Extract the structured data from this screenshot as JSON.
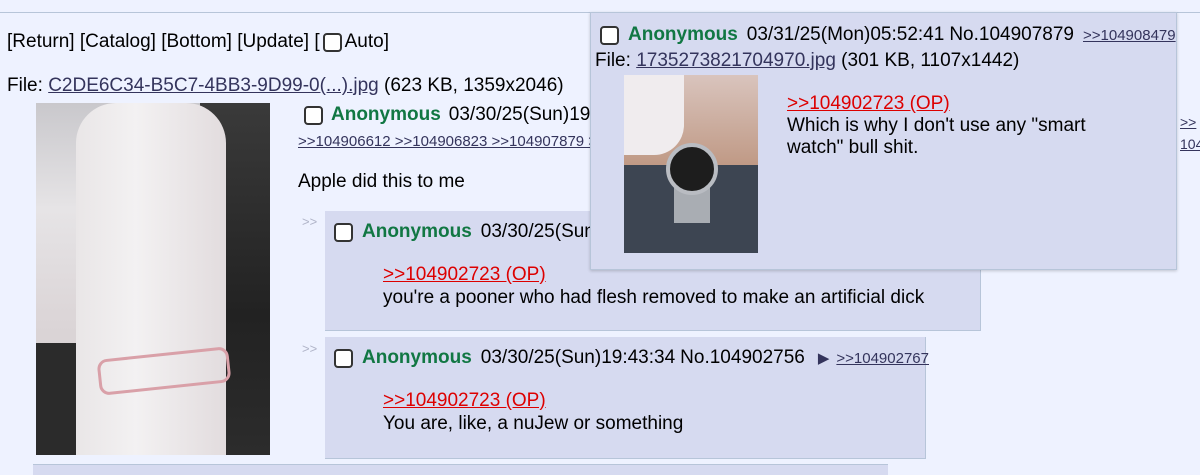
{
  "nav": {
    "return": "[Return]",
    "catalog": "[Catalog]",
    "bottom": "[Bottom]",
    "update": "[Update]",
    "auto_open": "[",
    "auto_label": "Auto]"
  },
  "op": {
    "file_prefix": "File: ",
    "file_name": "C2DE6C34-B5C7-4BB3-9D99-0(...).jpg",
    "file_info": " (623 KB, 1359x2046)",
    "name": "Anonymous",
    "datetime": "03/30/25(Sun)19:",
    "backlinks": ">>104906612 >>104906823 >>104907879 >",
    "text": "Apple did this to me"
  },
  "reply1": {
    "side": ">>",
    "name": "Anonymous",
    "datetime": "03/30/25(Sun)",
    "quote": ">>104902723 (OP)",
    "text": "you're a pooner who had flesh removed to make an artificial dick"
  },
  "reply2": {
    "side": ">>",
    "name": "Anonymous",
    "datetime": "03/30/25(Sun)19:43:34",
    "number": "No.104902756",
    "arrow": "▶",
    "backlink": ">>104902767",
    "quote": ">>104902723 (OP)",
    "text": "You are, like, a nuJew or something"
  },
  "popup": {
    "name": "Anonymous",
    "datetime": "03/31/25(Mon)05:52:41",
    "number": "No.104907879",
    "backlink": ">>104908479",
    "file_prefix": "File: ",
    "file_name": "1735273821704970.jpg",
    "file_info": " (301 KB, 1107x1442)",
    "quote": ">>104902723 (OP)",
    "text_line1": "Which is why I don't use any \"smart",
    "text_line2": "watch\" bull shit."
  },
  "edge": {
    "line1": ">>",
    "line2": "104"
  },
  "colors": {
    "background": "#eef2ff",
    "reply_bg": "#d6daf0",
    "name_green": "#117743",
    "quote_red": "#dd0000",
    "link": "#34345c"
  }
}
